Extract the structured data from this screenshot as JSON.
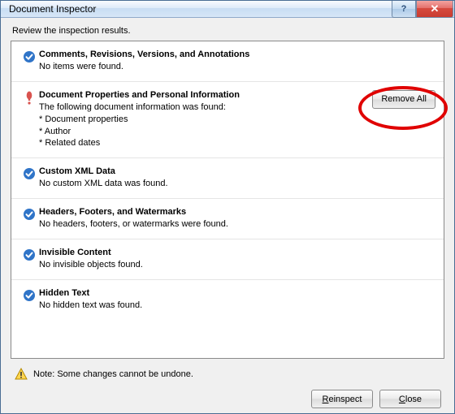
{
  "titlebar": {
    "title": "Document Inspector",
    "help_symbol": "?",
    "close_symbol": "✕"
  },
  "instruction": "Review the inspection results.",
  "sections": [
    {
      "status": "ok",
      "title": "Comments, Revisions, Versions, and Annotations",
      "desc": "No items were found."
    },
    {
      "status": "warn",
      "title": "Document Properties and Personal Information",
      "desc": "The following document information was found:",
      "bullets": [
        "* Document properties",
        "* Author",
        "* Related dates"
      ],
      "action_label": "Remove All"
    },
    {
      "status": "ok",
      "title": "Custom XML Data",
      "desc": "No custom XML data was found."
    },
    {
      "status": "ok",
      "title": "Headers, Footers, and Watermarks",
      "desc": "No headers, footers, or watermarks were found."
    },
    {
      "status": "ok",
      "title": "Invisible Content",
      "desc": "No invisible objects found."
    },
    {
      "status": "ok",
      "title": "Hidden Text",
      "desc": "No hidden text was found."
    }
  ],
  "footer": {
    "note": "Note: Some changes cannot be undone.",
    "reinspect_label": "Reinspect",
    "close_label": "Close"
  }
}
